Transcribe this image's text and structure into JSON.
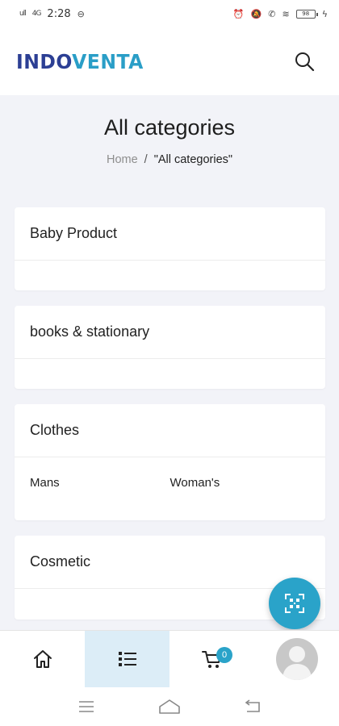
{
  "status_bar": {
    "time": "2:28",
    "signal_1": "ull",
    "signal_2": "4G",
    "battery": "98"
  },
  "header": {
    "logo_part_1": "INDO",
    "logo_part_2": "VENTA",
    "search_icon": "search-icon"
  },
  "page": {
    "title": "All categories",
    "breadcrumb": {
      "home": "Home",
      "separator": "/",
      "current": "\"All categories\""
    }
  },
  "categories": [
    {
      "name": "Baby Product",
      "subcategories": []
    },
    {
      "name": "books & stationary",
      "subcategories": []
    },
    {
      "name": "Clothes",
      "subcategories": [
        "Mans",
        "Woman's"
      ]
    },
    {
      "name": "Cosmetic",
      "subcategories": []
    }
  ],
  "fab": {
    "icon": "qr-scan-icon"
  },
  "bottom_nav": {
    "items": [
      {
        "icon": "home-icon"
      },
      {
        "icon": "list-icon",
        "active": true
      },
      {
        "icon": "cart-icon",
        "badge": "0"
      },
      {
        "icon": "avatar-icon"
      }
    ]
  },
  "colors": {
    "accent": "#2aa3c9",
    "logo_dark": "#2c3f94",
    "active_tab_bg": "#dcedf7",
    "page_bg": "#f2f3f8"
  }
}
